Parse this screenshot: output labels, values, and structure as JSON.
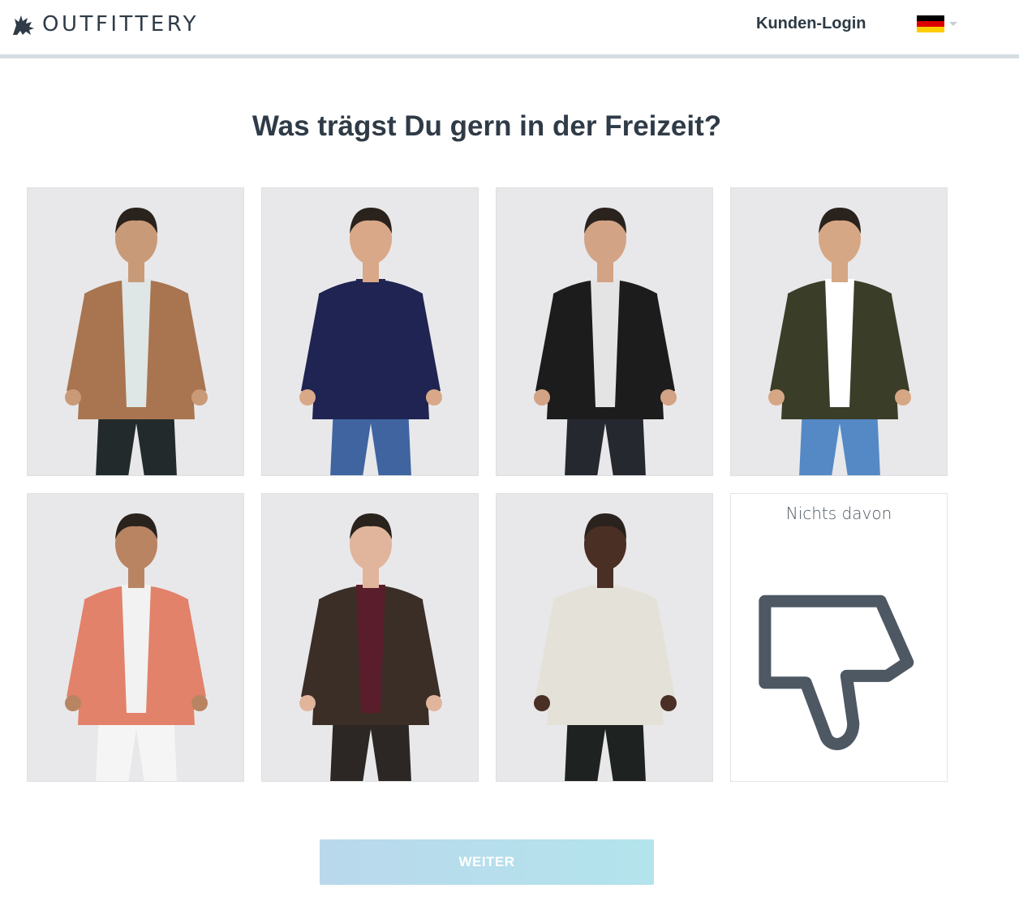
{
  "header": {
    "brand": "OUTFITTERY",
    "login_label": "Kunden-Login",
    "language": "de",
    "flag_colors": [
      "#000000",
      "#dd0000",
      "#ffce00"
    ]
  },
  "question": "Was trägst Du gern in der Freizeit?",
  "options": [
    {
      "style": "sakko-outfit",
      "jacket_color": "#a87550",
      "shirt_color": "#dfe6e6",
      "pants_color": "#232a2c",
      "skin": "#c99a78"
    },
    {
      "style": "strickpullover-outfit",
      "jacket_color": "#1f2452",
      "shirt_color": "#1f2452",
      "pants_color": "#3f64a0",
      "skin": "#d9a888"
    },
    {
      "style": "lederjacke-outfit",
      "jacket_color": "#1c1c1c",
      "shirt_color": "#e4e4e4",
      "pants_color": "#262830",
      "skin": "#d2a384"
    },
    {
      "style": "bomberjacke-outfit",
      "jacket_color": "#3a3d28",
      "shirt_color": "#ffffff",
      "pants_color": "#5589c6",
      "skin": "#d6a784"
    },
    {
      "style": "overshirt-outfit",
      "jacket_color": "#e2826a",
      "shirt_color": "#f2f2f2",
      "pants_color": "#f5f5f5",
      "skin": "#b98462"
    },
    {
      "style": "steppjacke-outfit",
      "jacket_color": "#3a2e27",
      "shirt_color": "#5a1d2b",
      "pants_color": "#2c2724",
      "skin": "#e0b59c"
    },
    {
      "style": "kurzarmhemd-outfit",
      "jacket_color": "#e4e2d8",
      "shirt_color": "#e4e2d8",
      "pants_color": "#1e2220",
      "skin": "#4a2f24"
    }
  ],
  "none_option": {
    "label": "Nichts davon",
    "icon": "thumbs-down-icon"
  },
  "submit": {
    "label": "WEITER"
  }
}
